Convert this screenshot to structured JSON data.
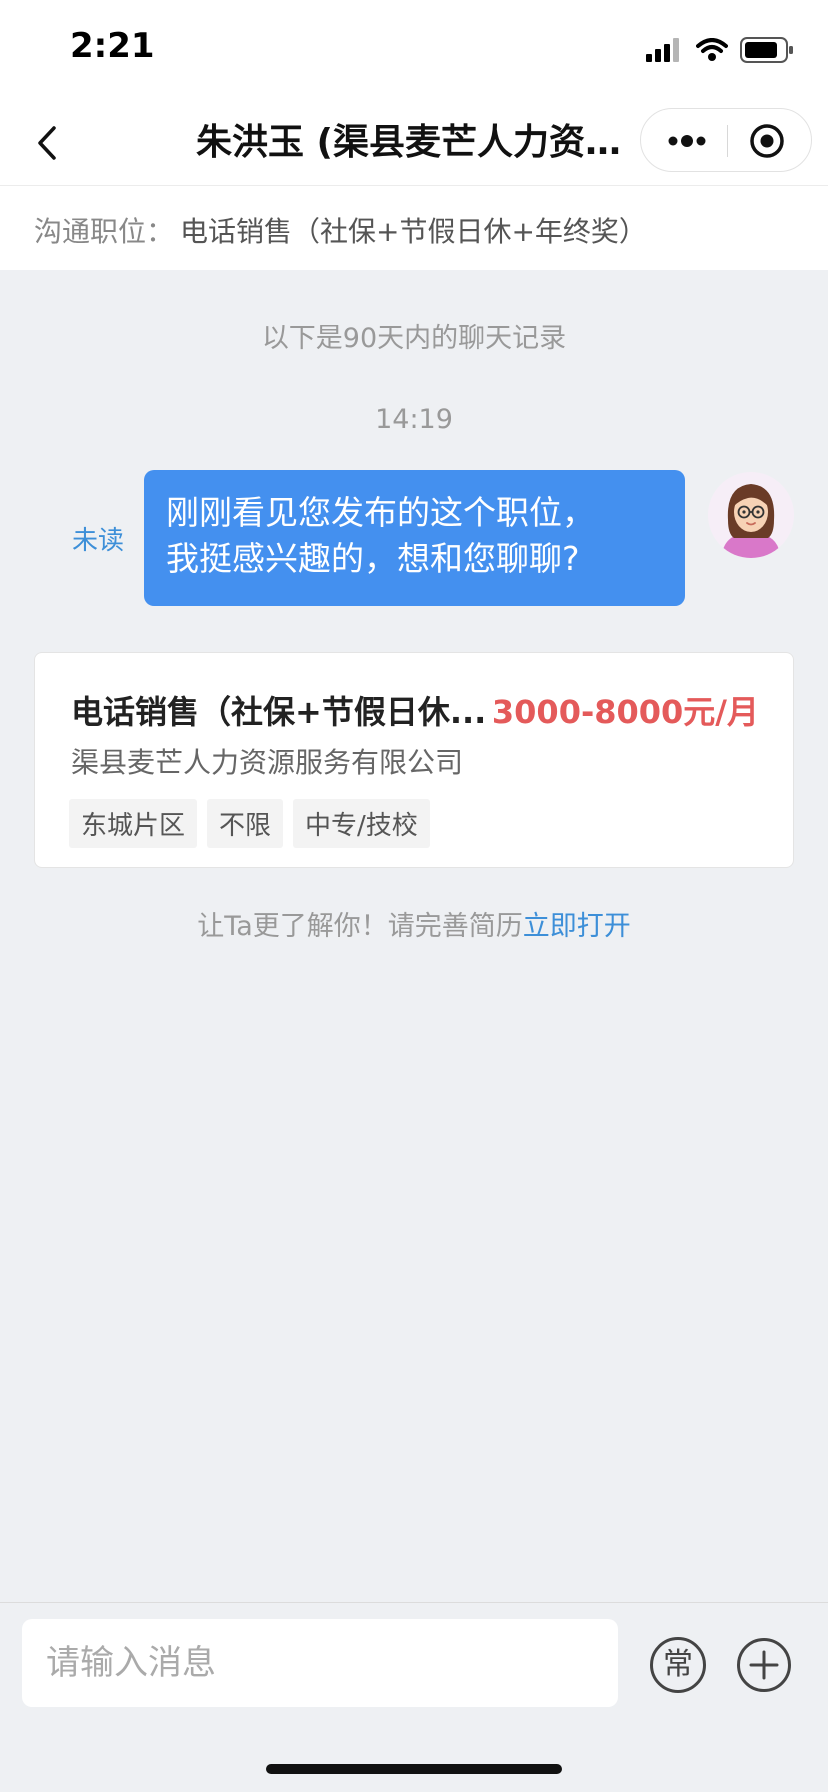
{
  "status_bar": {
    "time": "2:21",
    "icons": [
      "signal-icon",
      "wifi-icon",
      "battery-icon"
    ]
  },
  "nav": {
    "title": "朱洪玉 (渠县麦芒人力资源...",
    "icons": [
      "back-icon",
      "more-icon",
      "close-target-icon"
    ]
  },
  "job_bar": {
    "label": "沟通职位：",
    "value": "电话销售（社保+节假日休+年终奖）"
  },
  "chat": {
    "history_note": "以下是90天内的聊天记录",
    "timestamp": "14:19",
    "unread_label": "未读",
    "message_line1": "刚刚看见您发布的这个职位，",
    "message_line2": "我挺感兴趣的，想和您聊聊?"
  },
  "job_card": {
    "title": "电话销售（社保+节假日休...",
    "salary": "3000-8000元/月",
    "company": "渠县麦芒人力资源服务有限公司",
    "tags": [
      "东城片区",
      "不限",
      "中专/技校"
    ]
  },
  "resume_hint": {
    "text": "让Ta更了解你！请完善简历",
    "link": "立即打开"
  },
  "input_bar": {
    "placeholder": "请输入消息",
    "common_label": "常"
  },
  "colors": {
    "accent_blue": "#4490ef",
    "link_blue": "#3d8fd8",
    "salary_red": "#e45a5a",
    "background": "#eef0f3"
  }
}
